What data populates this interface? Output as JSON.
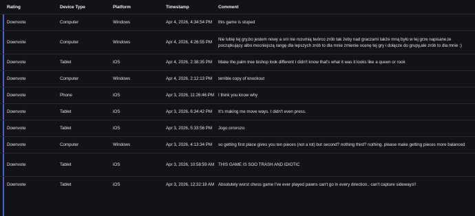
{
  "headers": {
    "rating": "Rating",
    "device": "Device Type",
    "platform": "Platform",
    "timestamp": "Timestamp",
    "comment": "Comment"
  },
  "rows": [
    {
      "rating": "Downvote",
      "device": "Computer",
      "platform": "Windows",
      "timestamp": "Apr 4, 2026, 4:34:54 PM",
      "comment": "this game is stuped"
    },
    {
      "rating": "Downvote",
      "device": "Computer",
      "platform": "Windows",
      "timestamp": "Apr 4, 2026, 4:26:55 PM",
      "comment": "Nie lubię tej gry,bo jestem nowy a oni nie rozumią twórco zrób tak żeby nad graczami także mną było w tej grze napisane,te początkujący albo mocniejszą rangę dla lepszych zrób to dla mnie zmienie ocenę tej gry i dołącze do grupy,ale zrób to dla mnie :)"
    },
    {
      "rating": "Downvote",
      "device": "Tablet",
      "platform": "iOS",
      "timestamp": "Apr 4, 2026, 2:38:35 PM",
      "comment": "Make the palm tree bishop look different I didn't know that's what it was it looks like a queen or rook"
    },
    {
      "rating": "Downvote",
      "device": "Computer",
      "platform": "Windows",
      "timestamp": "Apr 4, 2026, 2:12:13 PM",
      "comment": "terrible copy of knockout"
    },
    {
      "rating": "Downvote",
      "device": "Phone",
      "platform": "iOS",
      "timestamp": "Apr 3, 2026, 11:26:46 PM",
      "comment": "I think you know why"
    },
    {
      "rating": "Downvote",
      "device": "Tablet",
      "platform": "iOS",
      "timestamp": "Apr 3, 2026, 6:34:42 PM",
      "comment": "It's making me move ways. I didn't even press."
    },
    {
      "rating": "Downvote",
      "device": "Tablet",
      "platform": "iOS",
      "timestamp": "Apr 3, 2026, 5:33:56 PM",
      "comment": "Jogo orrorozo"
    },
    {
      "rating": "Downvote",
      "device": "Computer",
      "platform": "Windows",
      "timestamp": "Apr 3, 2026, 4:13:34 PM",
      "comment": "so getting first place gives you ten pieces (not a lot) but second? nothing third? nothing. please make getting pieces more balanced"
    },
    {
      "rating": "Downvote",
      "device": "Tablet",
      "platform": "iOS",
      "timestamp": "Apr 3, 2026, 10:58:59 AM",
      "comment": "THIS GAME IS SOO TRASH AND IDIOTIC"
    },
    {
      "rating": "Downvote",
      "device": "Tablet",
      "platform": "iOS",
      "timestamp": "Apr 3, 2026, 12:32:18 AM",
      "comment": "Absolutely worst chess game I've ever played pawns can't go in every direction.. can't capture sideways!!"
    }
  ]
}
